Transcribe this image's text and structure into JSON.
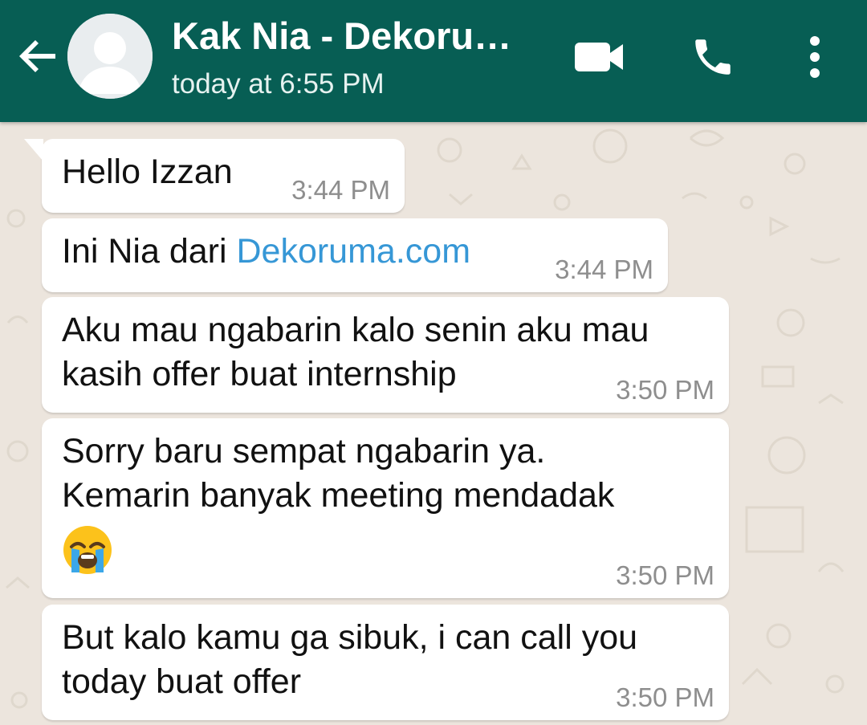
{
  "header": {
    "contact_name": "Kak Nia - Dekoru…",
    "status": "today at 6:55 PM",
    "icons": {
      "back": "arrow-left-icon",
      "avatar": "default-avatar-icon",
      "video": "video-camera-icon",
      "phone": "phone-icon",
      "menu": "vertical-dots-icon"
    }
  },
  "messages": [
    {
      "line1": "Hello Izzan",
      "time": "3:44 PM"
    },
    {
      "prefix": "Ini Nia dari ",
      "link": "Dekoruma.com",
      "time": "3:44 PM"
    },
    {
      "line1": "Aku mau ngabarin kalo senin aku mau",
      "line2": "kasih offer buat internship",
      "time": "3:50 PM"
    },
    {
      "line1": "Sorry baru sempat ngabarin ya.",
      "line2": "Kemarin banyak meeting mendadak",
      "emoji": "loudly-crying-face-emoji",
      "time": "3:50 PM"
    },
    {
      "line1": "But kalo kamu ga sibuk, i can call you",
      "line2": "today buat offer",
      "time": "3:50 PM"
    }
  ],
  "colors": {
    "header": "#075e54",
    "chat_background": "#ece5dd",
    "bubble": "#ffffff",
    "link": "#3697d6",
    "timestamp": "#8e8e8e"
  }
}
